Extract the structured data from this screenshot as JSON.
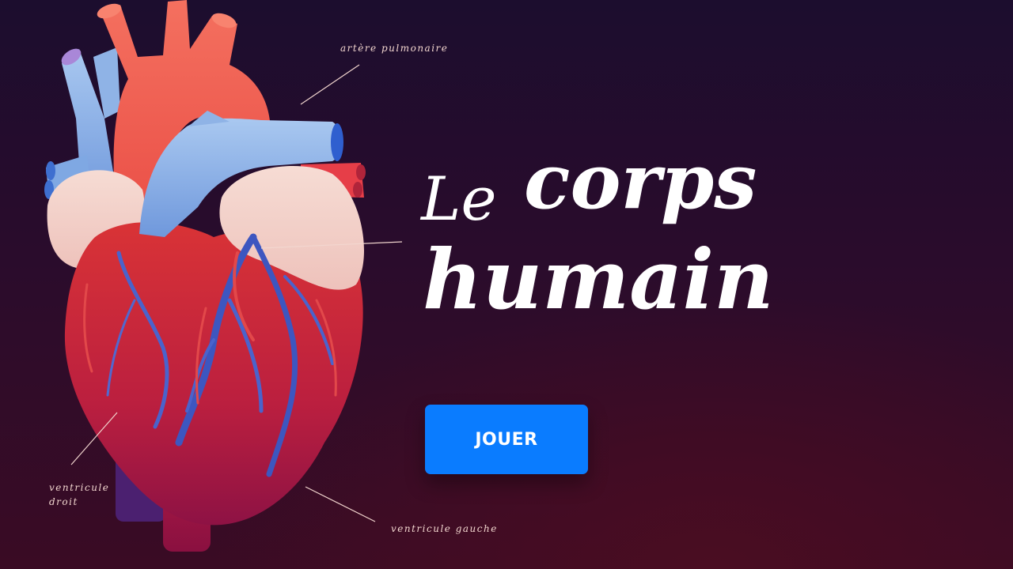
{
  "title": {
    "word1": "Le",
    "word2": "corps",
    "word3": "humain"
  },
  "labels": {
    "pulmonary_artery": "artère pulmonaire",
    "right_ventricle": "ventricule droit",
    "left_ventricle": "ventricule gauche"
  },
  "play_button": {
    "label": "JOUER"
  },
  "colors": {
    "accent": "#0a7cff",
    "artery_red": "#f0564f",
    "vein_blue": "#7fa8e3",
    "heart_red": "#c8283a",
    "atrium_pink": "#f3cfc8"
  }
}
